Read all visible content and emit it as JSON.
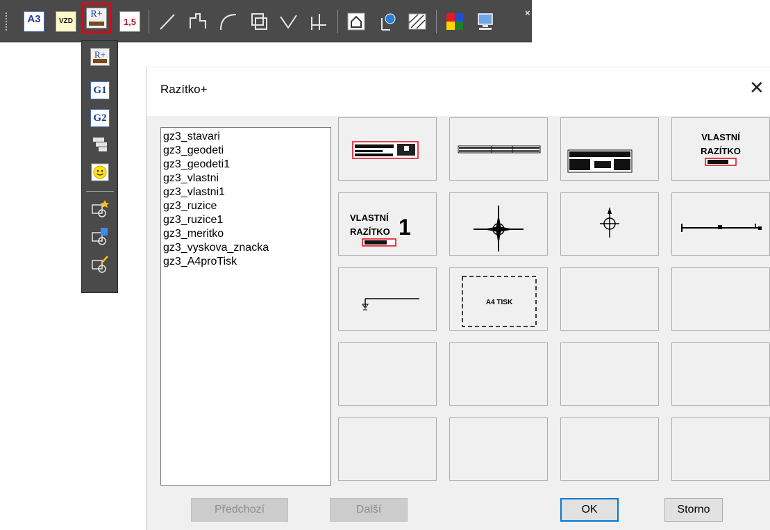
{
  "toolbar": {
    "items": [
      {
        "label": "A3",
        "icon": "a3-format-icon"
      },
      {
        "label": "VZD",
        "icon": "vzd-icon"
      },
      {
        "label": "R+",
        "icon": "stamp-plus-icon"
      },
      {
        "label": "1,5",
        "icon": "scale-icon"
      },
      {
        "icon": "line-icon"
      },
      {
        "icon": "polyline-icon"
      },
      {
        "icon": "arc-icon"
      },
      {
        "icon": "rectangle-icon"
      },
      {
        "icon": "angle-icon"
      },
      {
        "icon": "dimension-icon"
      },
      {
        "icon": "house-icon"
      },
      {
        "icon": "globe-icon"
      },
      {
        "icon": "hatch-icon"
      },
      {
        "icon": "color-palette-icon"
      },
      {
        "icon": "settings-monitor-icon"
      }
    ],
    "close": "×",
    "highlight_color": "#e60012"
  },
  "flyout": {
    "items": [
      {
        "label": "R+",
        "icon": "stamp-plus-icon"
      },
      {
        "label": "G1",
        "icon": "g1-icon"
      },
      {
        "label": "G2",
        "icon": "g2-icon"
      },
      {
        "icon": "layers-icon"
      },
      {
        "icon": "smiley-icon"
      },
      {
        "icon": "new-block-icon"
      },
      {
        "icon": "copy-block-icon"
      },
      {
        "icon": "edit-block-icon"
      }
    ]
  },
  "dialog": {
    "title": "Razítko+",
    "close": "✕",
    "list": [
      "gz3_stavari",
      "gz3_geodeti",
      "gz3_geodeti1",
      "gz3_vlastni",
      "gz3_vlastni1",
      "gz3_ruzice",
      "gz3_ruzice1",
      "gz3_meritko",
      "gz3_vyskova_znacka",
      "gz3_A4proTisk"
    ],
    "previews": {
      "vlastni_line1": "VLASTNÍ",
      "vlastni_line2": "RAZÍTKO",
      "vlastni1_line1": "VLASTNÍ",
      "vlastni1_line2": "RAZÍTKO",
      "vlastni1_number": "1",
      "a4_text": "A4 TISK"
    },
    "buttons": {
      "prev": "Předchozí",
      "next": "Další",
      "ok": "OK",
      "cancel": "Storno"
    }
  }
}
